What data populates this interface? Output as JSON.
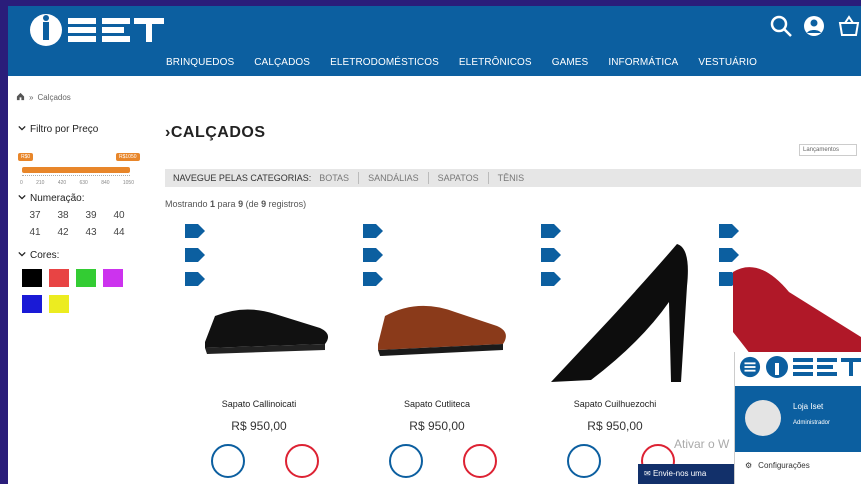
{
  "header": {
    "logo_text": "ISET",
    "nav": [
      "BRINQUEDOS",
      "CALÇADOS",
      "ELETRODOMÉSTICOS",
      "ELETRÔNICOS",
      "GAMES",
      "INFORMÁTICA",
      "VESTUÁRIO"
    ],
    "icons": [
      "search-icon",
      "user-icon",
      "cart-icon"
    ],
    "colors": {
      "brand": "#0c5fa0",
      "accent": "#e8862a"
    }
  },
  "breadcrumb": {
    "current": "Calçados"
  },
  "sidebar": {
    "price_filter_title": "Filtro por Preço",
    "price_min_tag": "R$0",
    "price_max_tag": "R$1050",
    "price_scale": [
      "0",
      "210",
      "420",
      "630",
      "840",
      "1050"
    ],
    "size_title": "Numeração:",
    "sizes": [
      "37",
      "38",
      "39",
      "40",
      "41",
      "42",
      "43",
      "44"
    ],
    "colors_title": "Cores:",
    "color_swatches": [
      "#000000",
      "#e84444",
      "#33cc33",
      "#cc33ee",
      "#1a1ad6",
      "#ecec20"
    ]
  },
  "main": {
    "title": "CALÇADOS",
    "sort_selected": "Lançamentos",
    "categories_label": "NAVEGUE PELAS CATEGORIAS:",
    "categories": [
      "BOTAS",
      "SANDÁLIAS",
      "SAPATOS",
      "TÊNIS"
    ],
    "showing_prefix": "Mostrando ",
    "showing_from": "1",
    "showing_mid": " para ",
    "showing_to": "9",
    "showing_paren": " (de ",
    "showing_total": "9",
    "showing_suffix": " registros)",
    "products": [
      {
        "name": "Sapato Callinoicati",
        "price": "R$ 950,00"
      },
      {
        "name": "Sapato Cutliteca",
        "price": "R$ 950,00"
      },
      {
        "name": "Sapato Cuilhuezochi",
        "price": "R$ 950,00"
      },
      {
        "name": "",
        "price": ""
      }
    ]
  },
  "overlay": {
    "watermark": "Ativar o W",
    "chat_label": "Envie-nos uma",
    "user_name": "Loja Iset",
    "user_role": "Administrador",
    "settings_label": "Configurações"
  }
}
